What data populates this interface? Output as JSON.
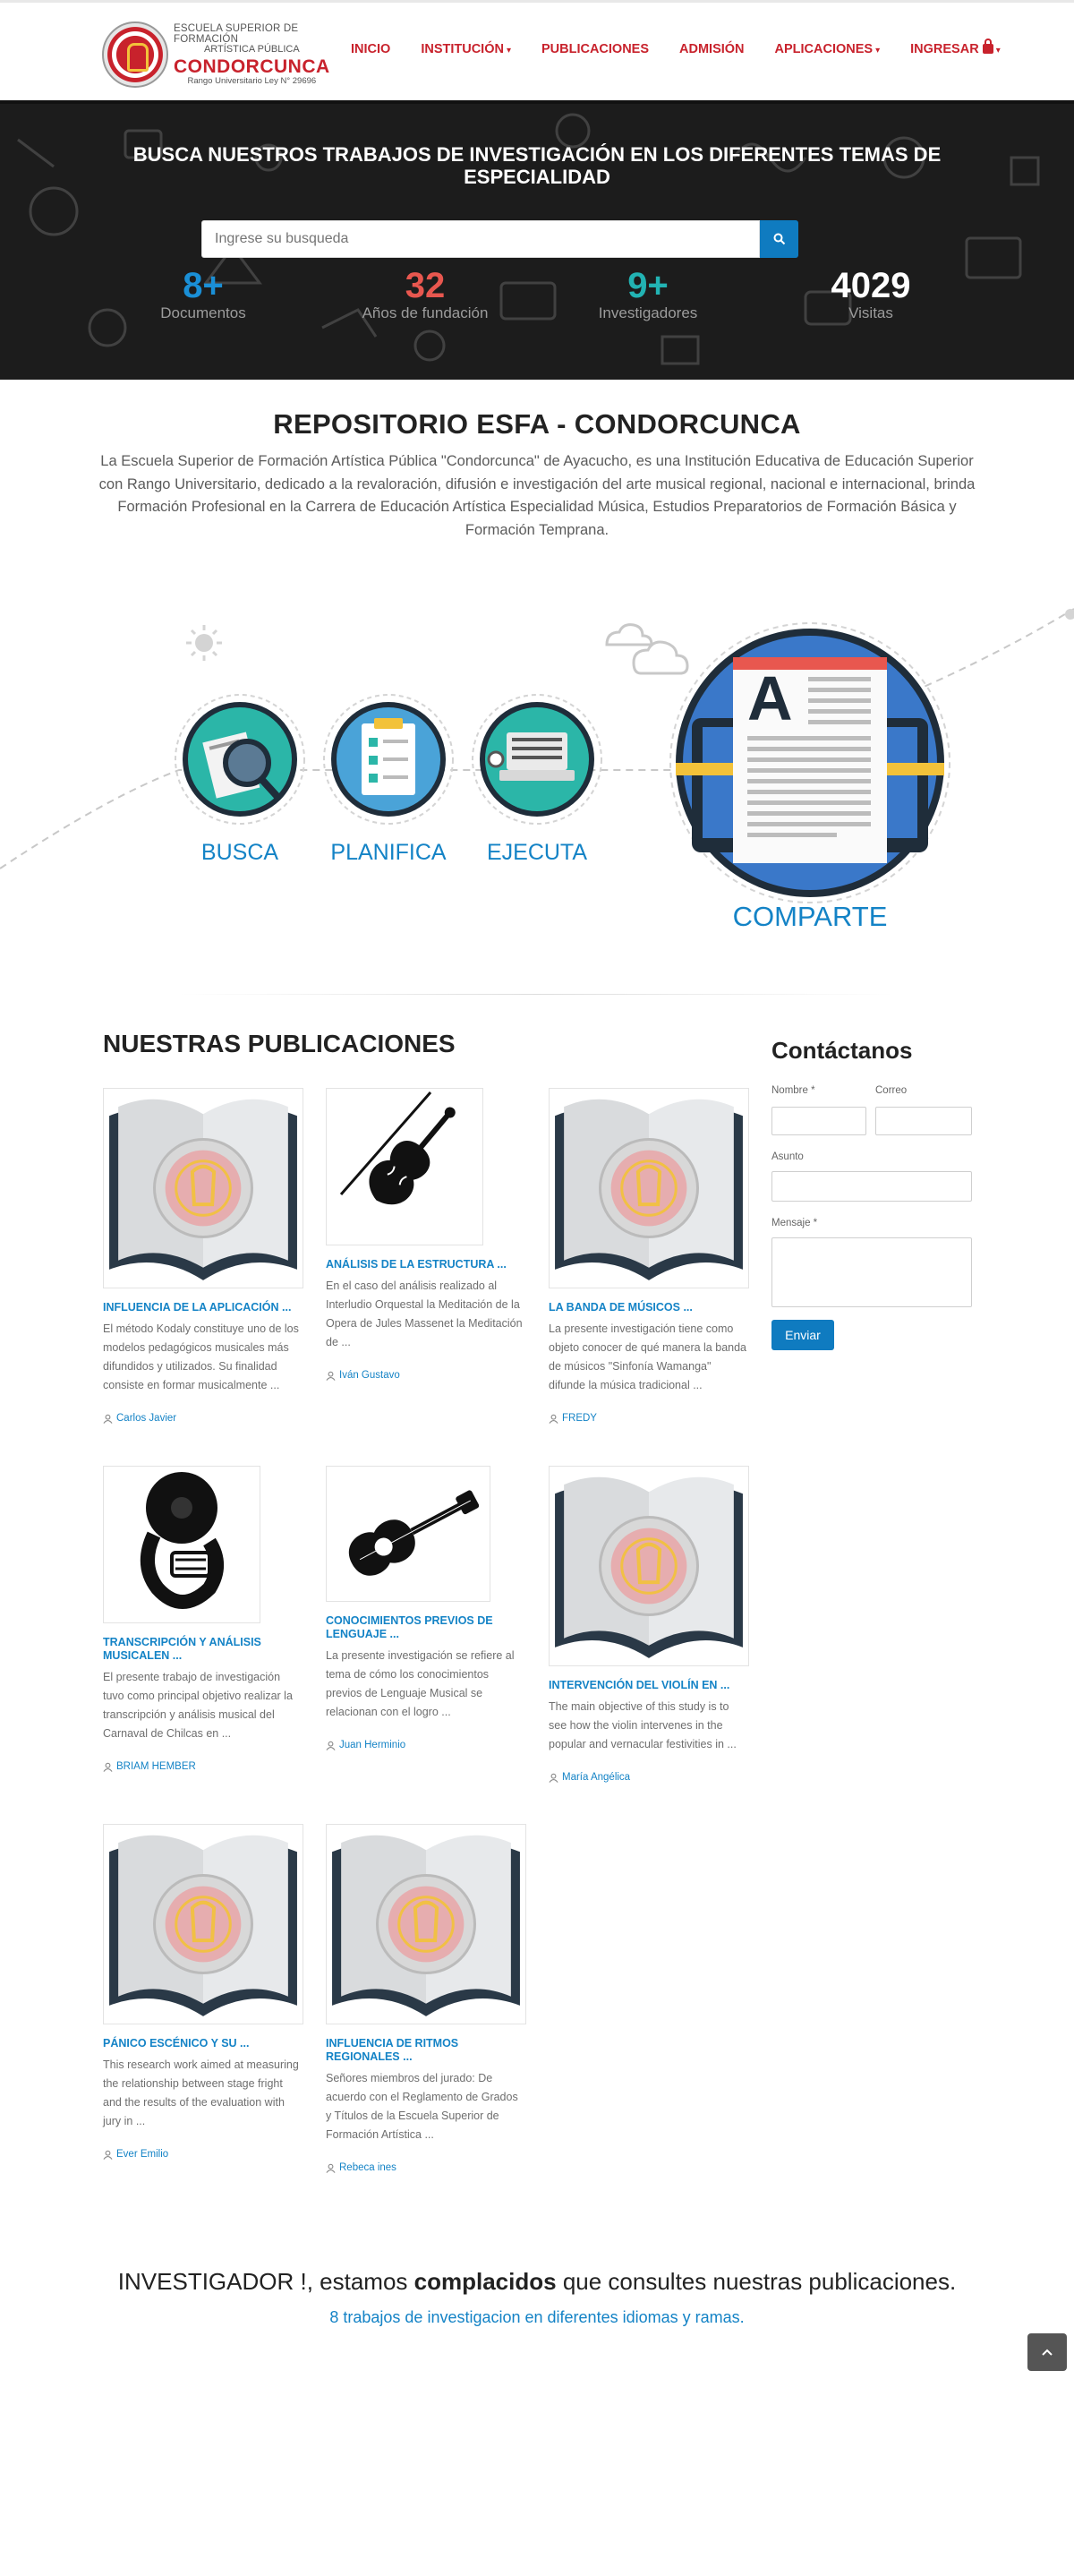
{
  "header": {
    "logo_line1": "ESCUELA SUPERIOR DE FORMACIÓN",
    "logo_line2": "ARTÍSTICA PÚBLICA",
    "logo_name": "CONDORCUNCA",
    "logo_sub": "Rango Universitario Ley N° 29696",
    "nav": [
      {
        "label": "INICIO",
        "dropdown": false
      },
      {
        "label": "INSTITUCIÓN",
        "dropdown": true
      },
      {
        "label": "PUBLICACIONES",
        "dropdown": false
      },
      {
        "label": "ADMISIÓN",
        "dropdown": false
      },
      {
        "label": "APLICACIONES",
        "dropdown": true
      },
      {
        "label": "INGRESAR",
        "dropdown": true
      }
    ]
  },
  "hero": {
    "title": "BUSCA NUESTROS TRABAJOS DE INVESTIGACIÓN EN LOS DIFERENTES TEMAS DE ESPECIALIDAD",
    "search_placeholder": "Ingrese su busqueda",
    "stats": [
      {
        "value": "8+",
        "label": "Documentos",
        "color": "#1a8fd6"
      },
      {
        "value": "32",
        "label": "Años de fundación",
        "color": "#e8574f"
      },
      {
        "value": "9+",
        "label": "Investigadores",
        "color": "#22b3b3"
      },
      {
        "value": "4029",
        "label": "Visitas",
        "color": "#ffffff"
      }
    ]
  },
  "about": {
    "title": "REPOSITORIO ESFA - CONDORCUNCA",
    "text": "La Escuela Superior de Formación Artística Pública \"Condorcunca\" de Ayacucho, es una Institución Educativa de Educación Superior con Rango Universitario, dedicado a la revaloración, difusión e investigación del arte musical regional, nacional e internacional, brinda Formación Profesional en la Carrera de Educación Artística Especialidad Música, Estudios Preparatorios de Formación Básica y Formación Temprana."
  },
  "process": {
    "steps": [
      "BUSCA",
      "PLANIFICA",
      "EJECUTA",
      "COMPARTE"
    ]
  },
  "publications": {
    "heading_light": "NUESTRAS ",
    "heading_bold": "PUBLICACIONES",
    "items": [
      {
        "title": "INFLUENCIA DE LA APLICACIÓN ...",
        "desc": "El método Kodaly constituye uno de los modelos pedagógicos musicales más difundidos y utilizados. Su finalidad consiste en formar musicalmente ...",
        "author": "Carlos Javier",
        "thumb": "book"
      },
      {
        "title": "ANÁLISIS DE LA ESTRUCTURA ...",
        "desc": "En el caso del análisis realizado al Interludio Orquestal la Meditación de la Opera de Jules Massenet la Meditación de ...",
        "author": "Iván Gustavo",
        "thumb": "violin"
      },
      {
        "title": "LA BANDA DE MÚSICOS ...",
        "desc": "La presente investigación tiene como objeto conocer de qué manera la banda de músicos \"Sinfonía Wamanga\" difunde la música tradicional ...",
        "author": "FREDY",
        "thumb": "book"
      },
      {
        "title": "TRANSCRIPCIÓN Y ANÁLISIS MUSICALEN ...",
        "desc": "El presente trabajo de investigación tuvo como principal objetivo realizar la transcripción y análisis musical del Carnaval de Chilcas en ...",
        "author": "BRIAM HEMBER",
        "thumb": "tuba"
      },
      {
        "title": "CONOCIMIENTOS PREVIOS DE LENGUAJE ...",
        "desc": "La presente investigación se refiere al tema de cómo los conocimientos previos de Lenguaje Musical se relacionan con el logro ...",
        "author": "Juan Herminio",
        "thumb": "guitar"
      },
      {
        "title": "INTERVENCIÓN DEL VIOLÍN EN ...",
        "desc": "The main objective of this study is to see how the violin intervenes in the popular and vernacular festivities in ...",
        "author": "María Angélica",
        "thumb": "book"
      },
      {
        "title": "PÁNICO ESCÉNICO Y SU ...",
        "desc": "This research work aimed at measuring the relationship between stage fright and the results of the evaluation with jury in ...",
        "author": "Ever Emilio",
        "thumb": "book"
      },
      {
        "title": "INFLUENCIA DE RITMOS REGIONALES ...",
        "desc": "Señores miembros del jurado: De acuerdo con el Reglamento de Grados y Títulos de la Escuela Superior de Formación Artística ...",
        "author": "Rebeca ines",
        "thumb": "book"
      }
    ]
  },
  "contact": {
    "title": "Contáctanos",
    "name_label": "Nombre *",
    "email_label": "Correo",
    "subject_label": "Asunto",
    "message_label": "Mensaje *",
    "send_label": "Enviar"
  },
  "cta": {
    "pre": "INVESTIGADOR !, estamos ",
    "bold": "complacidos",
    "post": " que consultes nuestras publicaciones.",
    "sub": "8 trabajos de investigacion en diferentes idiomas y ramas."
  }
}
